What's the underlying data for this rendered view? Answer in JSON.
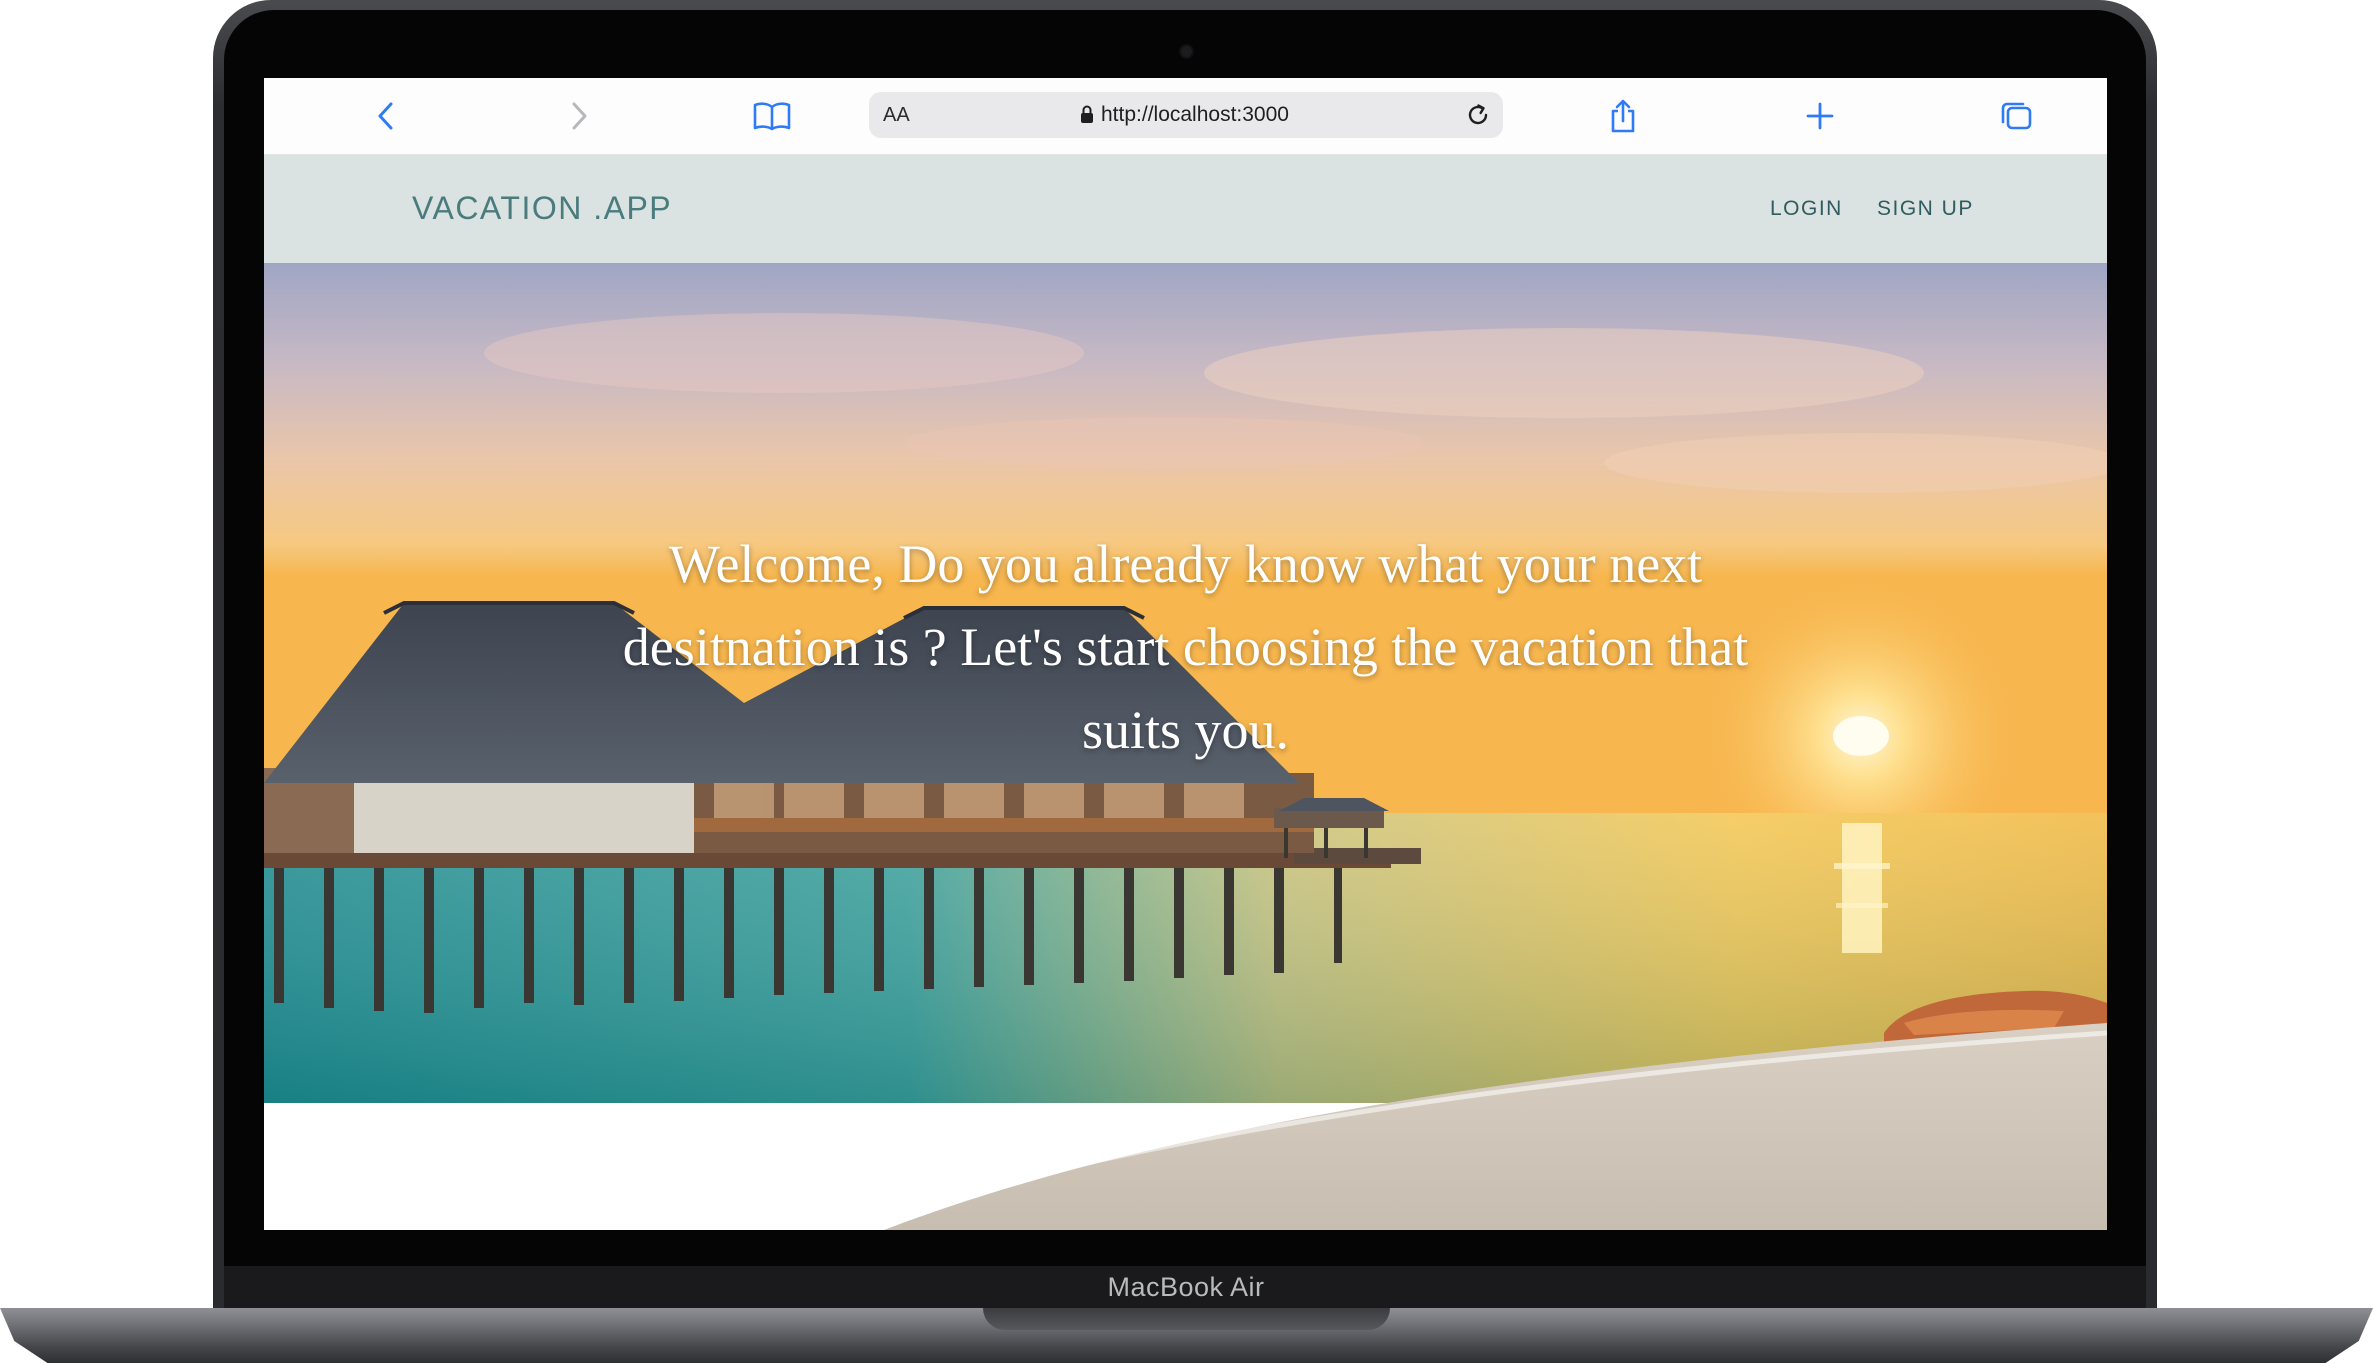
{
  "device": {
    "model_label": "MacBook Air"
  },
  "browser": {
    "text_size_label": "AA",
    "url": "http://localhost:3000",
    "icons": {
      "back": "chevron-left-icon",
      "forward": "chevron-right-icon",
      "bookmarks": "book-icon",
      "lock": "lock-icon",
      "reload": "reload-icon",
      "share": "share-icon",
      "new_tab": "plus-icon",
      "tabs": "tabs-icon"
    },
    "accent_color": "#2f7bf5"
  },
  "app": {
    "brand": "VACATION .APP",
    "nav": {
      "login": "LOGIN",
      "signup": "SIGN UP"
    },
    "colors": {
      "nav_background": "#dbe2e2",
      "brand_color": "#4a7c7e",
      "link_color": "#2f5c5e"
    },
    "hero": {
      "headline": "Welcome, Do you already know what your next desitnation is ? Let's start choosing the vacation that suits you.",
      "image": "tropical beach at sunset with overwater bungalow"
    }
  }
}
